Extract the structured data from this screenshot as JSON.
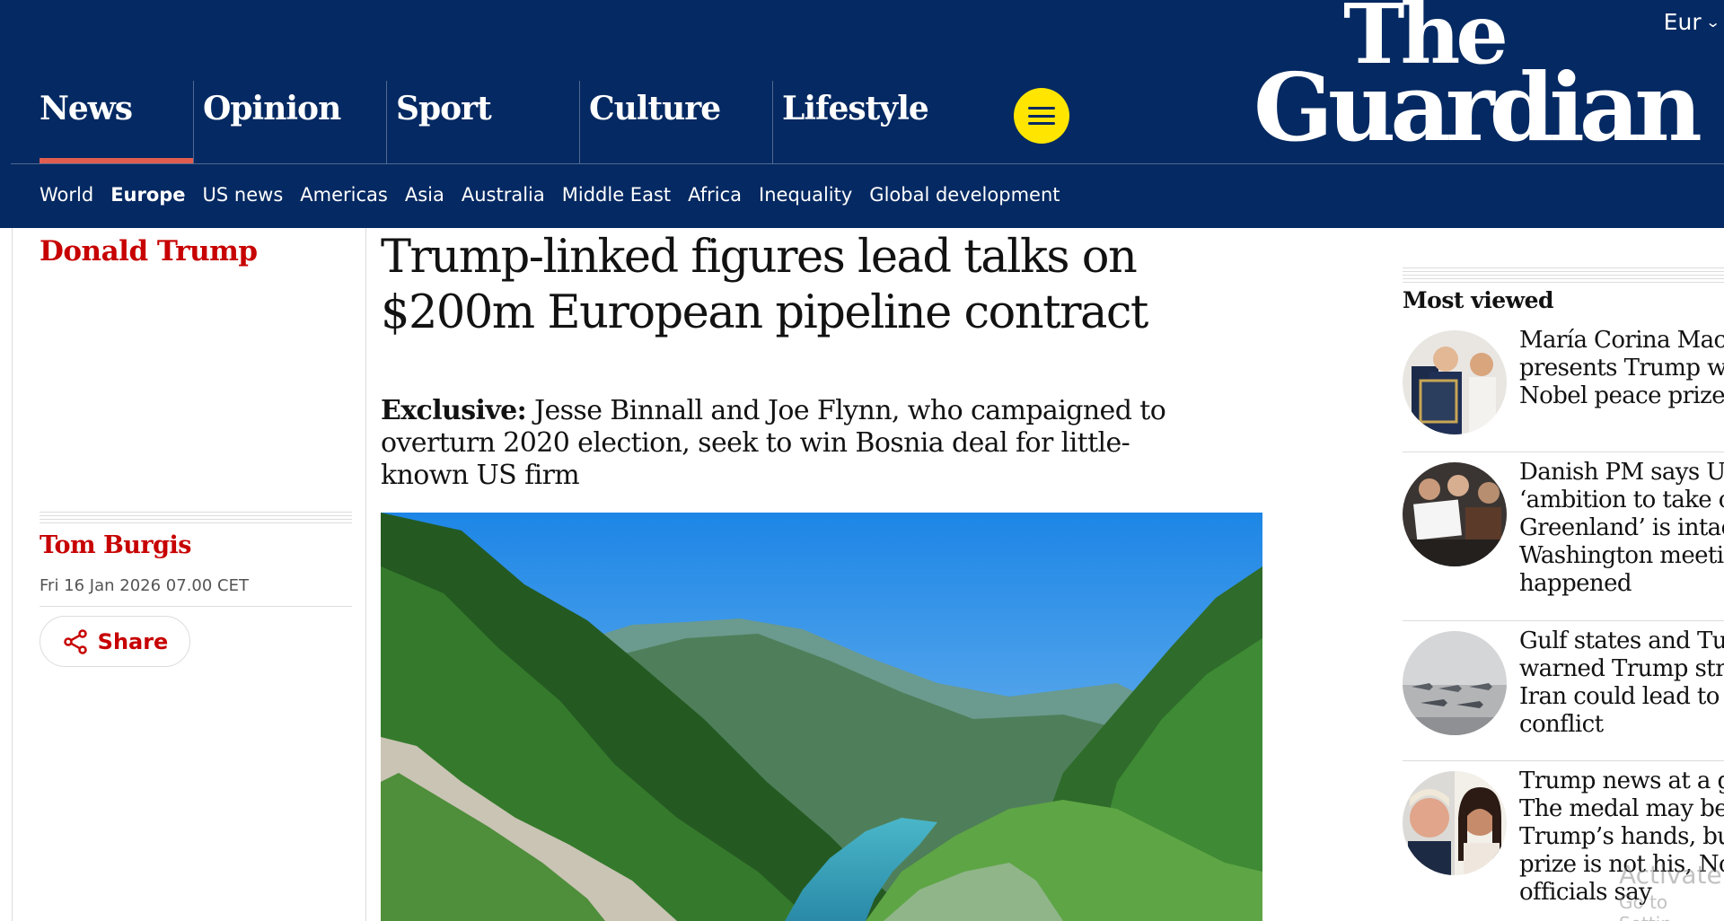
{
  "header": {
    "edition": "Eur",
    "logo_line1": "The",
    "logo_line2": "Guardian",
    "pillars": [
      {
        "label": "News",
        "active": true
      },
      {
        "label": "Opinion"
      },
      {
        "label": "Sport"
      },
      {
        "label": "Culture"
      },
      {
        "label": "Lifestyle"
      }
    ],
    "subnav": [
      {
        "label": "World"
      },
      {
        "label": "Europe",
        "current": true
      },
      {
        "label": "US news"
      },
      {
        "label": "Americas"
      },
      {
        "label": "Asia"
      },
      {
        "label": "Australia"
      },
      {
        "label": "Middle East"
      },
      {
        "label": "Africa"
      },
      {
        "label": "Inequality"
      },
      {
        "label": "Global development"
      }
    ]
  },
  "article": {
    "series": "Donald Trump",
    "headline": "Trump-linked figures lead talks on $200m European pipeline contract",
    "standfirst_kicker": "Exclusive:",
    "standfirst": " Jesse Binnall and Joe Flynn, who campaigned to overturn 2020 election, seek to win Bosnia deal for little-known US firm",
    "byline": "Tom Burgis",
    "date": "Fri 16 Jan 2026 07.00 CET",
    "share_label": "Share"
  },
  "most_viewed": {
    "title": "Most viewed",
    "items": [
      {
        "lines": [
          "María Corina Mach",
          "presents Trump wi",
          "Nobel peace prize r"
        ]
      },
      {
        "lines": [
          "Danish PM says US",
          "‘ambition to take o",
          "Greenland’ is intac",
          "Washington meetin",
          "happened"
        ]
      },
      {
        "lines": [
          "Gulf states and Tur",
          "warned Trump stri",
          "Iran could lead to r",
          "conflict"
        ]
      },
      {
        "lines": [
          "Trump news at a gl",
          "The medal may be",
          "Trump’s hands, but",
          "prize is not his, Nob",
          "officials say"
        ]
      }
    ]
  },
  "os_watermark": {
    "line1": "Activate",
    "line2": "Go to Settin"
  },
  "colors": {
    "brand_blue": "#052962",
    "news_red": "#c70000",
    "menu_yellow": "#ffe500",
    "active_underline": "#e05e50"
  }
}
